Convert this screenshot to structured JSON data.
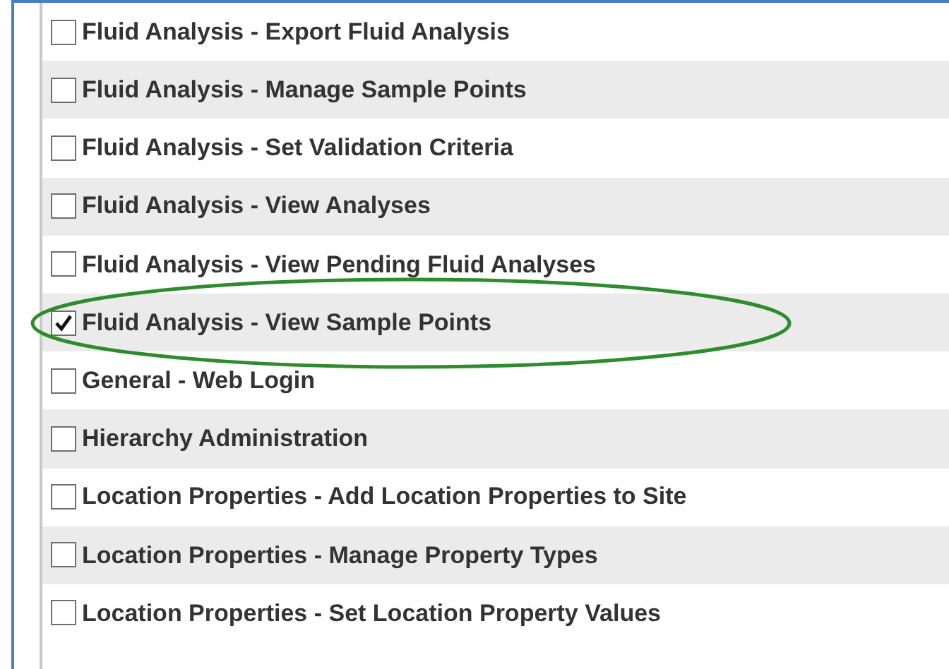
{
  "permissions": [
    {
      "label": "Fluid Analysis - Export Fluid Analysis",
      "checked": false,
      "highlighted": false
    },
    {
      "label": "Fluid Analysis - Manage Sample Points",
      "checked": false,
      "highlighted": false
    },
    {
      "label": "Fluid Analysis - Set Validation Criteria",
      "checked": false,
      "highlighted": false
    },
    {
      "label": "Fluid Analysis - View Analyses",
      "checked": false,
      "highlighted": false
    },
    {
      "label": "Fluid Analysis - View Pending Fluid Analyses",
      "checked": false,
      "highlighted": false
    },
    {
      "label": "Fluid Analysis - View Sample Points",
      "checked": true,
      "highlighted": true
    },
    {
      "label": "General - Web Login",
      "checked": false,
      "highlighted": false
    },
    {
      "label": "Hierarchy Administration",
      "checked": false,
      "highlighted": false
    },
    {
      "label": "Location Properties - Add Location Properties to Site",
      "checked": false,
      "highlighted": false
    },
    {
      "label": "Location Properties - Manage Property Types",
      "checked": false,
      "highlighted": false
    },
    {
      "label": "Location Properties - Set Location Property Values",
      "checked": false,
      "highlighted": false
    }
  ]
}
